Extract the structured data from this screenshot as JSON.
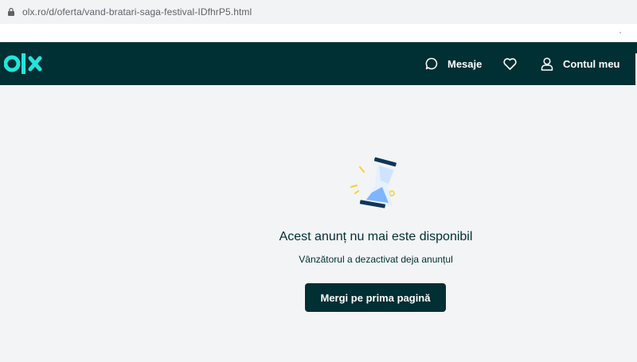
{
  "browser": {
    "url": "olx.ro/d/oferta/vand-bratari-saga-festival-IDfhrP5.html",
    "lock_icon": "lock-icon"
  },
  "header": {
    "logo_text": "olx",
    "background_color": "#002f34",
    "logo_color": "#23e5db",
    "nav": {
      "messages_label": "Mesaje",
      "messages_icon": "chat-bubble-icon",
      "favorites_icon": "heart-icon",
      "account_label": "Contul meu",
      "account_icon": "user-icon"
    }
  },
  "main": {
    "illustration_icon": "hourglass-icon",
    "title": "Acest anunț nu mai este disponibil",
    "subtitle": "Vânzătorul a dezactivat deja anunțul",
    "cta_label": "Mergi pe prima pagină",
    "background_color": "#f2f4f5"
  }
}
